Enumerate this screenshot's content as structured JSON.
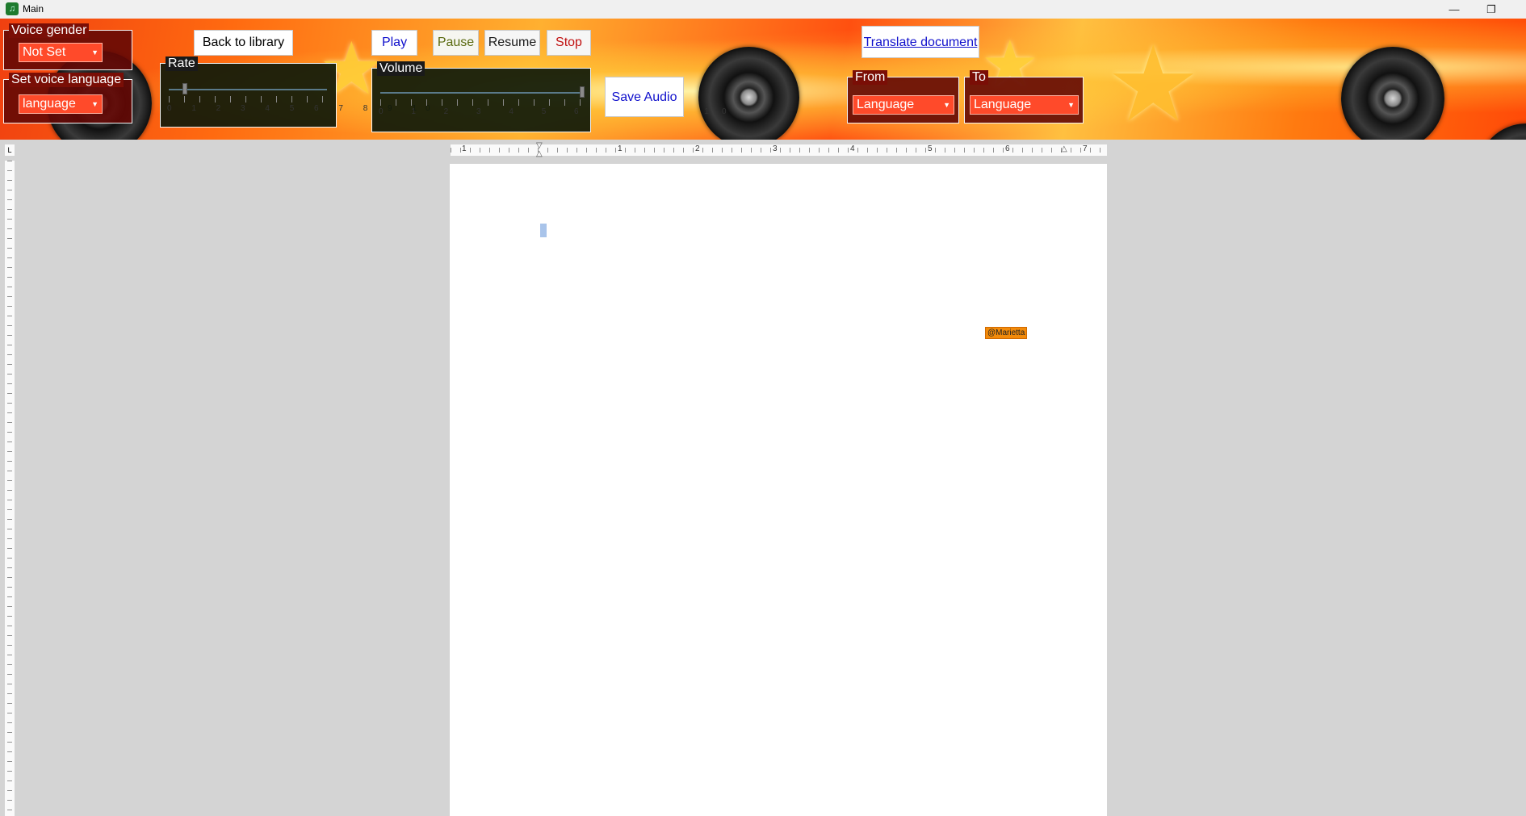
{
  "window": {
    "title": "Main"
  },
  "voice_gender": {
    "legend": "Voice gender",
    "value": "Not Set"
  },
  "voice_language": {
    "legend": "Set voice language",
    "value": "language"
  },
  "buttons": {
    "back": "Back to library",
    "play": "Play",
    "pause": "Pause",
    "resume": "Resume",
    "stop": "Stop",
    "save_audio": "Save Audio",
    "translate": "Translate document"
  },
  "rate": {
    "legend": "Rate",
    "ticks": "0 1 2 3 4 5 6 7 8 9 10",
    "value": 1,
    "min": 0,
    "max": 10
  },
  "volume": {
    "legend": "Volume",
    "ticks": "0 1 2 3 4 5 6 7 8 9 10",
    "value": 10,
    "min": 0,
    "max": 10
  },
  "translate_from": {
    "legend": "From",
    "value": "Language"
  },
  "translate_to": {
    "legend": "To",
    "value": "Language"
  },
  "ruler": {
    "marks": [
      "1",
      "1",
      "2",
      "3",
      "4",
      "5",
      "6",
      "7"
    ]
  },
  "document": {
    "tag": "@Marietta"
  },
  "colors": {
    "accent_orange": "#f28a0a",
    "combo_red": "#ff4a2a",
    "caret": "#a9c4ea"
  }
}
